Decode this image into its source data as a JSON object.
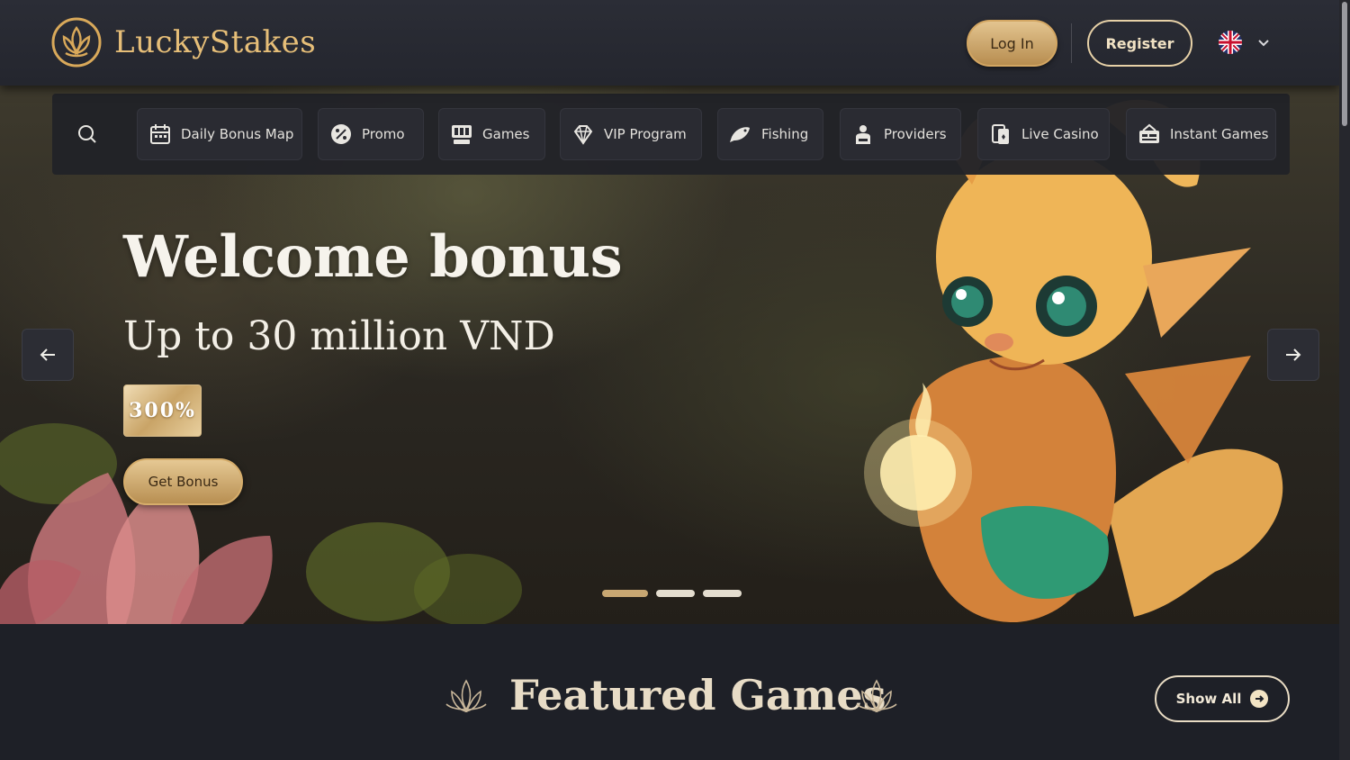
{
  "header": {
    "brand": "LuckyStakes",
    "login_label": "Log In",
    "register_label": "Register",
    "language_icon": "uk-flag-icon"
  },
  "nav": {
    "search_icon": "search-icon",
    "items": [
      {
        "label": "Daily Bonus Map",
        "icon": "calendar-icon"
      },
      {
        "label": "Promo",
        "icon": "percent-icon"
      },
      {
        "label": "Games",
        "icon": "slot-machine-icon"
      },
      {
        "label": "VIP Program",
        "icon": "diamond-icon"
      },
      {
        "label": "Fishing",
        "icon": "fish-icon"
      },
      {
        "label": "Providers",
        "icon": "dealer-icon"
      },
      {
        "label": "Live Casino",
        "icon": "cards-icon"
      },
      {
        "label": "Instant Games",
        "icon": "ticket-icon"
      }
    ]
  },
  "hero": {
    "title": "Welcome bonus",
    "subtitle": "Up to 30 million VND",
    "badge": "300%",
    "cta_label": "Get Bonus",
    "slide_index": 1,
    "slide_count": 3
  },
  "featured": {
    "title": "Featured Games",
    "show_all_label": "Show All"
  },
  "colors": {
    "gold": "#e6be78",
    "background": "#1e2027",
    "header": "#2b2d36"
  }
}
